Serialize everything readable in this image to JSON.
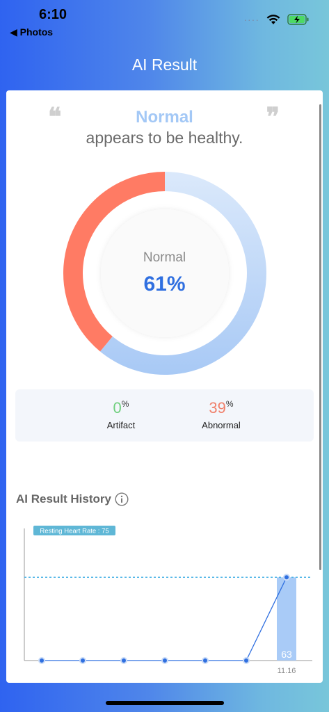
{
  "status_bar": {
    "time": "6:10",
    "back_label": "◀ Photos",
    "signal": "····"
  },
  "header": {
    "title": "AI Result"
  },
  "summary": {
    "quote_open": "❝",
    "quote_close": "❞",
    "headline": "Normal",
    "subline": "appears to be healthy."
  },
  "donut": {
    "center_label": "Normal",
    "center_value": "61%",
    "segments": [
      {
        "name": "Normal",
        "value": 61,
        "color": "#b7d4f8"
      },
      {
        "name": "Abnormal",
        "value": 39,
        "color": "#ff7b64"
      }
    ]
  },
  "stats": {
    "artifact": {
      "value": "0",
      "pct": "%",
      "label": "Artifact",
      "color": "#6fcf7d"
    },
    "abnormal": {
      "value": "39",
      "pct": "%",
      "label": "Abnormal",
      "color": "#f0806b"
    }
  },
  "history": {
    "title": "AI Result History"
  },
  "chart_data": {
    "type": "line",
    "title": "",
    "xlabel": "",
    "ylabel": "",
    "x": [
      "",
      "",
      "",
      "",
      "",
      "",
      "11.16"
    ],
    "values": [
      0,
      0,
      0,
      0,
      0,
      0,
      63
    ],
    "ylim": [
      0,
      100
    ],
    "bar_value": 63,
    "bar_label": "63",
    "reference_label": "Resting Heart Rate : 75",
    "grid": false,
    "legend": "none",
    "colors": {
      "line": "#2f6fe0",
      "bar": "#a9cbf7",
      "reference": "#4fb4e6"
    }
  }
}
